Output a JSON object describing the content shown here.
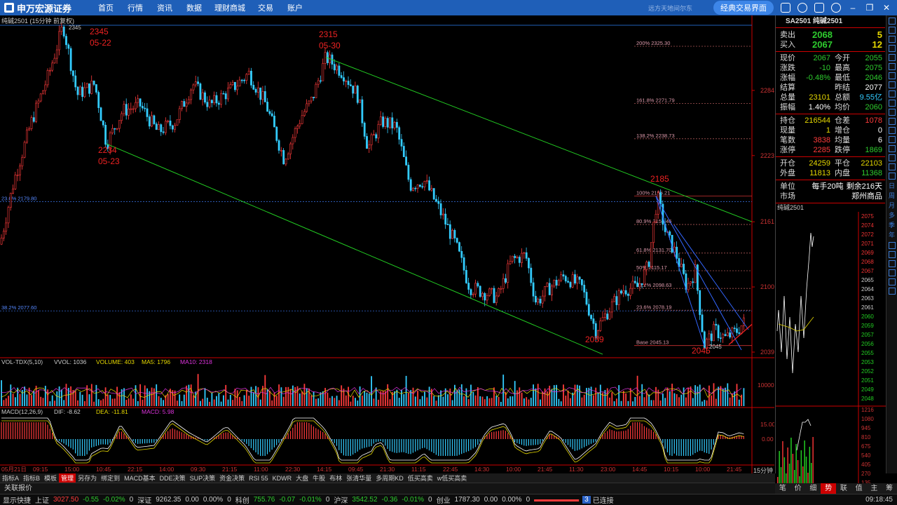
{
  "app": {
    "logo": "申万宏源证券",
    "nav": [
      "首页",
      "行情",
      "资讯",
      "数据",
      "理财商城",
      "交易",
      "账户"
    ],
    "slogan": "远方天地间尔东",
    "classic_button": "经典交易界面"
  },
  "chart": {
    "title": "纯碱2501 (15分钟 前复权)",
    "price_labels": [
      {
        "text": "2345",
        "sub": "05-22"
      },
      {
        "text": "2315",
        "sub": "05-30"
      },
      {
        "text": "2234",
        "sub": "05-23"
      },
      {
        "text": "2185"
      },
      {
        "text": "2059"
      },
      {
        "text": "2045"
      }
    ],
    "top_mark": "2345",
    "fib_right": [
      "200% 2325.30",
      "161.8% 2271.79",
      "138.2% 2238.73",
      "100% 2185.21",
      "80.9% 2158.46",
      "61.8% 2131.70",
      "50% 2115.17",
      "38.2% 2098.63",
      "23.6% 2078.19",
      "Base 2045.13"
    ],
    "fib_left": [
      "23.6% 2179.80",
      "38.2% 2077.60"
    ],
    "y_axis": [
      "2284",
      "2223",
      "2161",
      "2100",
      "2039"
    ],
    "vol_axis": "10000",
    "macd_axis": [
      "15.00",
      "0.00"
    ],
    "vol_legend": {
      "name": "VOL-TDX(5,10)",
      "vvol": "VVOL: 1036",
      "volume": "VOLUME: 403",
      "ma5": "MA5: 1796",
      "ma10": "MA10: 2318"
    },
    "macd_legend": {
      "name": "MACD(12,26,9)",
      "dif": "DIF: -8.62",
      "dea": "DEA: -11.81",
      "macd": "MACD: 5.98"
    },
    "x_axis": [
      "05月21日",
      "09:15",
      "15:00",
      "10:45",
      "22:15",
      "14:00",
      "09:30",
      "21:15",
      "11:00",
      "22:30",
      "14:15",
      "09:45",
      "21:30",
      "11:15",
      "22:45",
      "14:30",
      "10:00",
      "21:45",
      "11:30",
      "23:00",
      "14:45",
      "10:15",
      "10:00",
      "21:45"
    ],
    "period": "15分钟"
  },
  "quote": {
    "code": "SA2501",
    "name": "纯碱2501",
    "sell": {
      "label": "卖出",
      "price": "2068",
      "vol": "5"
    },
    "buy": {
      "label": "买入",
      "price": "2067",
      "vol": "12"
    },
    "rows1": [
      [
        "现价",
        "2067",
        "今开",
        "2055"
      ],
      [
        "涨跌",
        "-10",
        "最高",
        "2075"
      ],
      [
        "涨幅",
        "-0.48%",
        "最低",
        "2046"
      ],
      [
        "结算",
        "",
        "昨结",
        "2077"
      ],
      [
        "总量",
        "23101",
        "总额",
        "9.55亿"
      ],
      [
        "振幅",
        "1.40%",
        "均价",
        "2060"
      ]
    ],
    "rows2": [
      [
        "持仓",
        "216544",
        "仓差",
        "1078"
      ],
      [
        "现量",
        "1",
        "增仓",
        "0"
      ],
      [
        "笔数",
        "3838",
        "均量",
        "6"
      ],
      [
        "涨停",
        "2285",
        "跌停",
        "1869"
      ]
    ],
    "rows3": [
      [
        "开仓",
        "24259",
        "平仓",
        "22103"
      ],
      [
        "外盘",
        "11813",
        "内盘",
        "11368"
      ]
    ],
    "unit_label": "单位",
    "unit_value": "每手20吨",
    "remain": "剩余216天",
    "market_label": "市场",
    "market_value": "郑州商品",
    "mini_title": "纯碱2501",
    "mini_axis": [
      "2075",
      "2074",
      "2072",
      "2071",
      "2069",
      "2068",
      "2067",
      "2065",
      "2064",
      "2063",
      "2061",
      "2060",
      "2059",
      "2057",
      "2056",
      "2055",
      "2053",
      "2052",
      "2051",
      "2049",
      "2048",
      "1216",
      "1080",
      "945",
      "810",
      "675",
      "540",
      "405",
      "270",
      "135"
    ]
  },
  "toolbar": [
    "指标A",
    "指标B",
    "模板",
    "管理",
    "另存为",
    "绑定到",
    "MACD基本",
    "DDE决策",
    "SUP决策",
    "资金决策",
    "RSI 55",
    "KDWR",
    "大盘",
    "牛股",
    "布林",
    "张清华量",
    "多周期KD",
    "低买高卖",
    "w低买高卖"
  ],
  "bottom_tab": "关联报价",
  "right_tabs": [
    "笔",
    "价",
    "细",
    "势",
    "联",
    "值",
    "主",
    "筹"
  ],
  "right_strip_text": [
    "日",
    "周",
    "月",
    "多",
    "季",
    "年"
  ],
  "status": {
    "quick": "显示快捷",
    "sh": {
      "name": "上证",
      "price": "3027.50",
      "chg": "-0.55",
      "pct": "-0.02%",
      "vol": "0"
    },
    "sz": {
      "name": "深证",
      "price": "9262.35",
      "chg": "0.00",
      "pct": "0.00%",
      "vol": "0"
    },
    "kc": {
      "name": "科创",
      "price": "755.76",
      "chg": "-0.07",
      "pct": "-0.01%",
      "vol": "0"
    },
    "hs": {
      "name": "沪深",
      "price": "3542.52",
      "chg": "-0.36",
      "pct": "-0.01%",
      "vol": "0"
    },
    "cy": {
      "name": "创业",
      "price": "1787.30",
      "chg": "0.00",
      "pct": "0.00%",
      "vol": "0"
    },
    "conn": "已连接",
    "conn_badge": "3",
    "time": "09:18:45"
  }
}
